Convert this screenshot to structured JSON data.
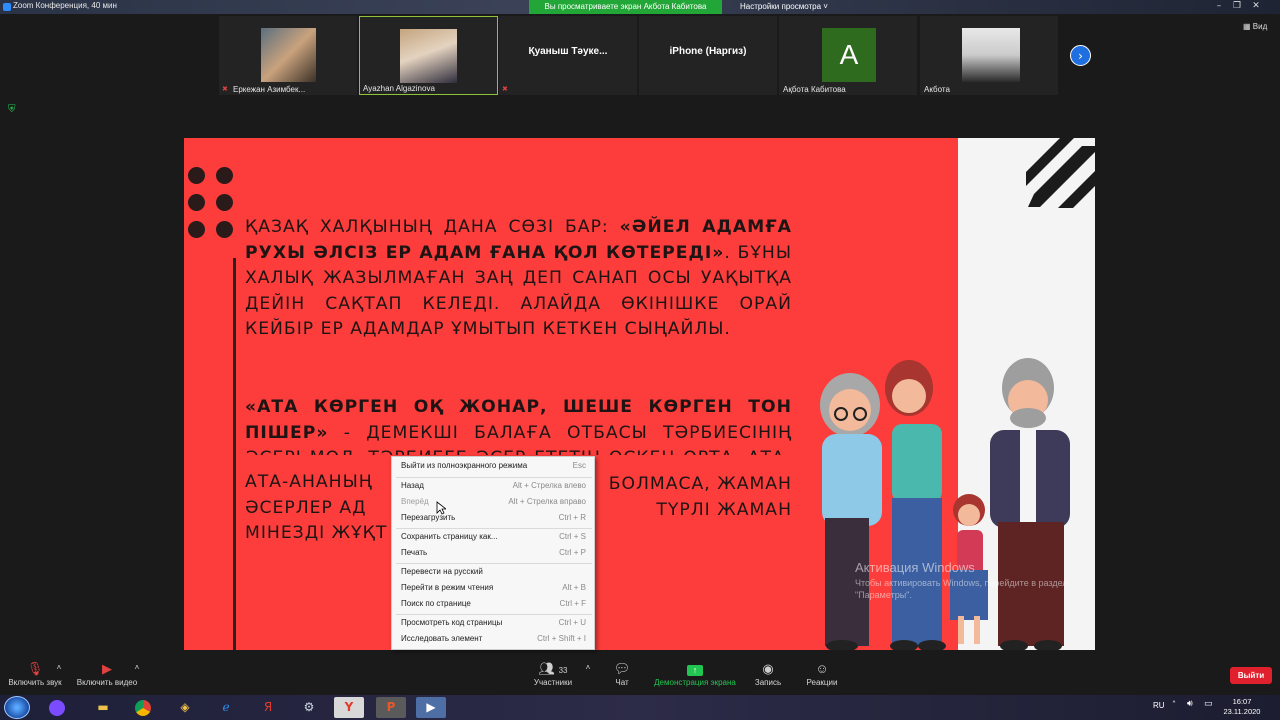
{
  "window": {
    "title": "Zoom Конференция, 40 мин",
    "share_banner": "Вы просматриваете экран Акбота Кабитова",
    "view_options": "Настройки просмотра ˅",
    "view_label": "Вид"
  },
  "participants": [
    {
      "name": "Еркежан Азимбек..."
    },
    {
      "name": "Ayazhan Algazinova"
    },
    {
      "name": "Қуаныш Тәуке..."
    },
    {
      "name": "iPhone (Наргиз)"
    },
    {
      "name": "Ақбота Кабитова",
      "initial": "A"
    },
    {
      "name": "Акбота"
    }
  ],
  "slide": {
    "para1_a": "ҚАЗАҚ ХАЛҚЫНЫҢ ДАНА СӨЗІ БАР: ",
    "para1_b": "«ӘЙЕЛ АДАМҒА РУХЫ ӘЛСІЗ ЕР АДАМ ҒАНА ҚОЛ КӨТЕРЕДІ»",
    "para1_c": ". БҰНЫ ХАЛЫҚ ЖАЗЫЛМАҒАН ЗАҢ ДЕП САНАП ОСЫ УАҚЫТҚА ДЕЙІН САҚТАП КЕЛЕДІ. АЛАЙДА ӨКІНІШКЕ ОРАЙ КЕЙБІР ЕР АДАМДАР ҰМЫТЫП КЕТКЕН СЫҢАЙЛЫ.",
    "para2_a": "«АТА КӨРГЕН ОҚ ЖОНАР, ШЕШЕ КӨРГЕН ТОН ПІШЕР»",
    "para2_b": " - ДЕМЕКШІ БАЛАҒА ОТБАСЫ ТӘРБИЕСІНІҢ ӘСЕРІ МОЛ. ТӘРБИЕГЕ ӘСЕР ЕТЕТІН ӨСКЕН ОРТА. АТА-АНАНЫҢ",
    "para2_c": "БОЛМАСА, ЖАМАН",
    "para2_d": "ӘСЕРЛЕР АД",
    "para2_e": "ТҮРЛІ ЖАМАН",
    "para2_f": "МІНЕЗДІ ЖҰҚТ"
  },
  "context_menu": [
    {
      "label": "Выйти из полноэкранного режима",
      "shortcut": "Esc",
      "disabled": false
    },
    {
      "label": "Назад",
      "shortcut": "Alt + Стрелка влево",
      "disabled": false
    },
    {
      "label": "Вперёд",
      "shortcut": "Alt + Стрелка вправо",
      "disabled": true
    },
    {
      "label": "Перезагрузить",
      "shortcut": "Ctrl + R",
      "disabled": false
    },
    {
      "label": "Сохранить страницу как...",
      "shortcut": "Ctrl + S",
      "disabled": false
    },
    {
      "label": "Печать",
      "shortcut": "Ctrl + P",
      "disabled": false
    },
    {
      "label": "Перевести на русский",
      "shortcut": "",
      "disabled": false
    },
    {
      "label": "Перейти в режим чтения",
      "shortcut": "Alt + B",
      "disabled": false
    },
    {
      "label": "Поиск по странице",
      "shortcut": "Ctrl + F",
      "disabled": false
    },
    {
      "label": "Просмотреть код страницы",
      "shortcut": "Ctrl + U",
      "disabled": false
    },
    {
      "label": "Исследовать элемент",
      "shortcut": "Ctrl + Shift + I",
      "disabled": false
    }
  ],
  "watermark": {
    "title": "Активация Windows",
    "text": "Чтобы активировать Windows, перейдите в раздел \"Параметры\"."
  },
  "toolbar": {
    "mic": "Включить звук",
    "video": "Включить видео",
    "participants": "Участники",
    "participants_count": "33",
    "chat": "Чат",
    "share": "Демонстрация экрана",
    "record": "Запись",
    "reactions": "Реакции",
    "leave": "Выйти"
  },
  "taskbar": {
    "lang": "RU",
    "time": "16:07",
    "date": "23.11.2020"
  },
  "colors": {
    "slide_red": "#fc3d3b",
    "share_green": "#23a638",
    "leave_red": "#e0202d"
  }
}
